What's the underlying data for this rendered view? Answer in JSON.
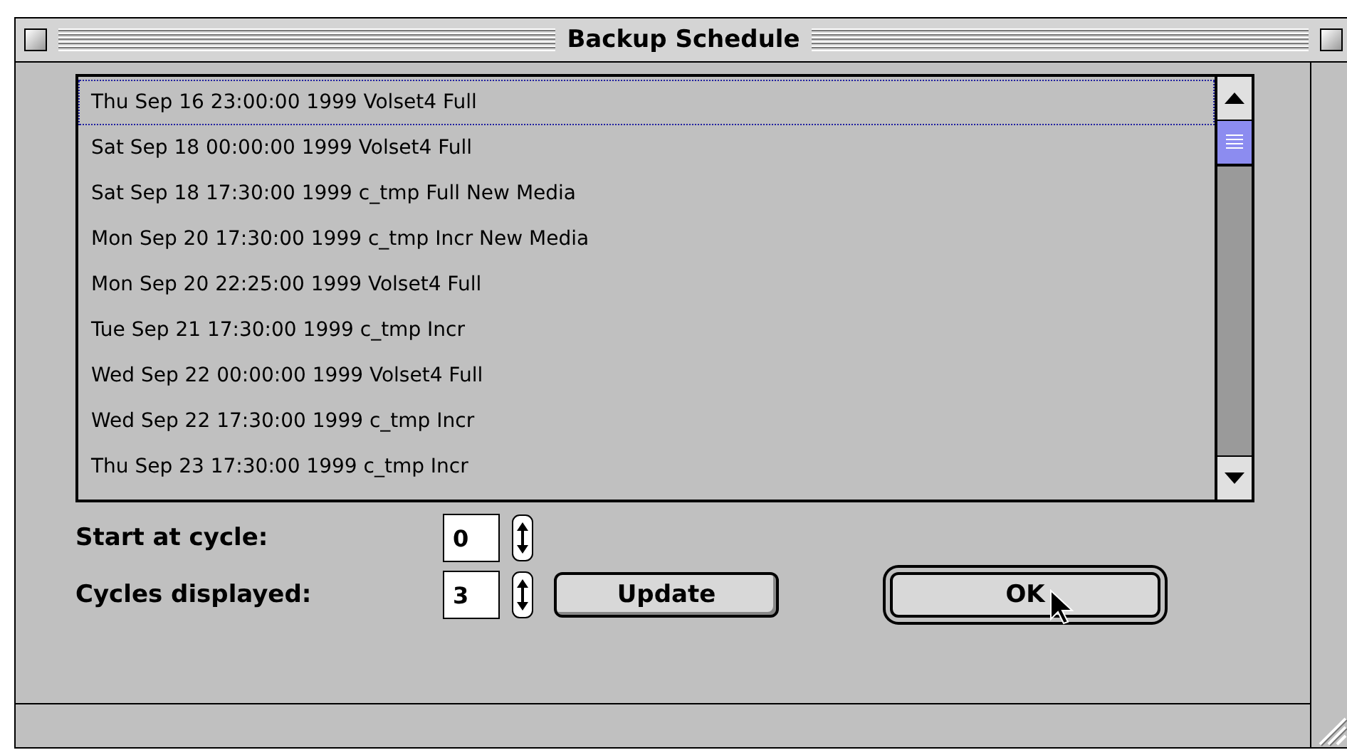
{
  "window": {
    "title": "Backup Schedule"
  },
  "schedule": [
    {
      "text": "Thu Sep 16 23:00:00 1999 Volset4 Full",
      "selected": true
    },
    {
      "text": "Sat Sep 18 00:00:00 1999 Volset4 Full",
      "selected": false
    },
    {
      "text": "Sat Sep 18 17:30:00 1999 c_tmp Full New Media",
      "selected": false
    },
    {
      "text": "Mon Sep 20 17:30:00 1999 c_tmp Incr New Media",
      "selected": false
    },
    {
      "text": "Mon Sep 20 22:25:00 1999 Volset4 Full",
      "selected": false
    },
    {
      "text": "Tue Sep 21 17:30:00 1999 c_tmp Incr",
      "selected": false
    },
    {
      "text": "Wed Sep 22 00:00:00 1999 Volset4 Full",
      "selected": false
    },
    {
      "text": "Wed Sep 22 17:30:00 1999 c_tmp Incr",
      "selected": false
    },
    {
      "text": "Thu Sep 23 17:30:00 1999 c_tmp Incr",
      "selected": false
    }
  ],
  "fields": [
    {
      "label": "Start at cycle:",
      "value": "0"
    },
    {
      "label": "Cycles displayed:",
      "value": "3"
    }
  ],
  "buttons": [
    {
      "label": "Update",
      "kind": "normal"
    },
    {
      "label": "OK",
      "kind": "default"
    }
  ]
}
